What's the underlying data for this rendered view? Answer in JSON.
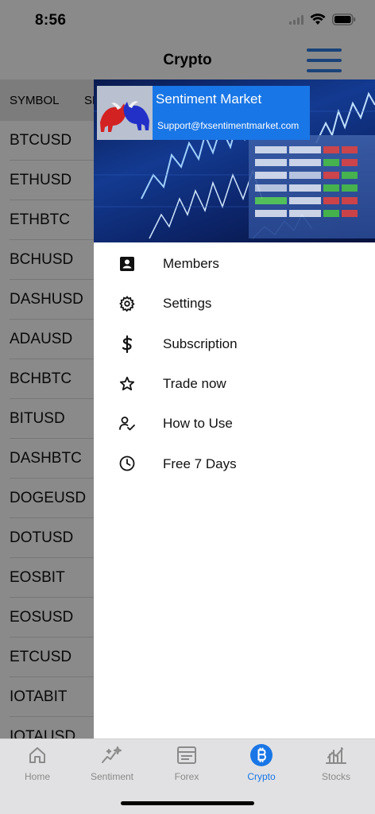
{
  "status": {
    "time": "8:56"
  },
  "nav": {
    "title": "Crypto"
  },
  "table": {
    "headers": [
      "SYMBOL",
      "SHORT"
    ],
    "rows": [
      "BTCUSD",
      "ETHUSD",
      "ETHBTC",
      "BCHUSD",
      "DASHUSD",
      "ADAUSD",
      "BCHBTC",
      "BITUSD",
      "DASHBTC",
      "DOGEUSD",
      "DOTUSD",
      "EOSBIT",
      "EOSUSD",
      "ETCUSD",
      "IOTABIT",
      "IOTAUSD"
    ]
  },
  "drawer": {
    "brand_title": "Sentiment Market",
    "brand_email": "Support@fxsentimentmarket.com",
    "items": [
      {
        "label": "Members",
        "icon": "contact-card-icon"
      },
      {
        "label": "Settings",
        "icon": "gear-icon"
      },
      {
        "label": "Subscription",
        "icon": "dollar-icon"
      },
      {
        "label": "Trade now",
        "icon": "star-icon"
      },
      {
        "label": "How to Use",
        "icon": "user-check-icon"
      },
      {
        "label": "Free 7 Days",
        "icon": "clock-icon"
      }
    ]
  },
  "tabs": [
    {
      "label": "Home",
      "icon": "home-icon",
      "active": false
    },
    {
      "label": "Sentiment",
      "icon": "chart-sparkle-icon",
      "active": false
    },
    {
      "label": "Forex",
      "icon": "forex-card-icon",
      "active": false
    },
    {
      "label": "Crypto",
      "icon": "bitcoin-icon",
      "active": true
    },
    {
      "label": "Stocks",
      "icon": "stocks-icon",
      "active": false
    }
  ],
  "colors": {
    "accent": "#1976e6",
    "brand_box": "#1976e6",
    "header_bg": "#e6e6e6"
  }
}
